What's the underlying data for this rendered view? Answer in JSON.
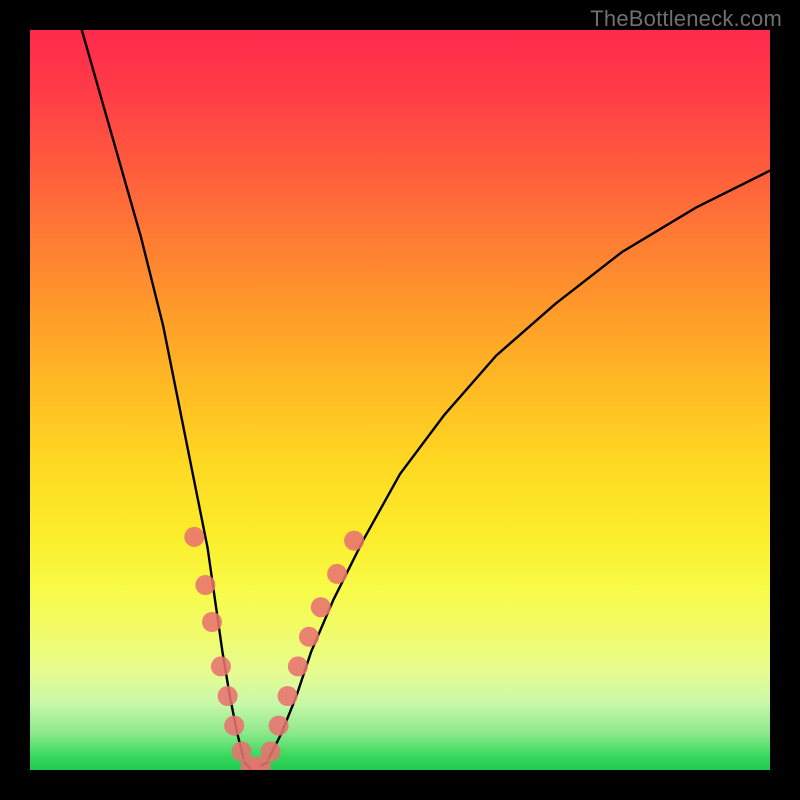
{
  "watermark": "TheBottleneck.com",
  "chart_data": {
    "type": "line",
    "title": "",
    "xlabel": "",
    "ylabel": "",
    "xlim": [
      0,
      100
    ],
    "ylim": [
      0,
      100
    ],
    "series": [
      {
        "name": "bottleneck-curve",
        "x": [
          7,
          11,
          15,
          18,
          20,
          22,
          24,
          25,
          26,
          27,
          28,
          29,
          30,
          32,
          34,
          36,
          38,
          41,
          45,
          50,
          56,
          63,
          71,
          80,
          90,
          100
        ],
        "values": [
          100,
          86,
          72,
          60,
          50,
          40,
          30,
          23,
          16,
          10,
          5,
          1,
          0,
          1,
          5,
          10,
          16,
          23,
          31,
          40,
          48,
          56,
          63,
          70,
          76,
          81
        ]
      }
    ],
    "marker_group": {
      "name": "highlighted-points",
      "color": "#e8726f",
      "points": [
        {
          "x": 22.2,
          "y": 31.5
        },
        {
          "x": 23.7,
          "y": 25.0
        },
        {
          "x": 24.6,
          "y": 20.0
        },
        {
          "x": 25.8,
          "y": 14.0
        },
        {
          "x": 26.7,
          "y": 10.0
        },
        {
          "x": 27.6,
          "y": 6.0
        },
        {
          "x": 28.6,
          "y": 2.5
        },
        {
          "x": 29.8,
          "y": 0.5
        },
        {
          "x": 31.2,
          "y": 0.5
        },
        {
          "x": 32.5,
          "y": 2.5
        },
        {
          "x": 33.6,
          "y": 6.0
        },
        {
          "x": 34.8,
          "y": 10.0
        },
        {
          "x": 36.2,
          "y": 14.0
        },
        {
          "x": 37.7,
          "y": 18.0
        },
        {
          "x": 39.3,
          "y": 22.0
        },
        {
          "x": 41.5,
          "y": 26.5
        },
        {
          "x": 43.8,
          "y": 31.0
        }
      ]
    },
    "gradient_stops": [
      {
        "pos": 0.0,
        "color": "#ff2a4d"
      },
      {
        "pos": 0.5,
        "color": "#ffd722"
      },
      {
        "pos": 0.8,
        "color": "#f0fb6e"
      },
      {
        "pos": 1.0,
        "color": "#1fc94f"
      }
    ]
  }
}
